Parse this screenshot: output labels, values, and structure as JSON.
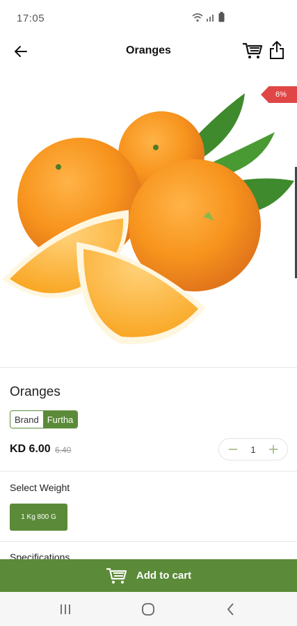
{
  "status_bar": {
    "time": "17:05"
  },
  "header": {
    "title": "Oranges"
  },
  "hero": {
    "discount_badge": "6%"
  },
  "product": {
    "name": "Oranges",
    "brand_label": "Brand",
    "brand_value": "Furtha",
    "price": "KD 6.00",
    "old_price": "6.40",
    "quantity": "1"
  },
  "weight": {
    "section_label": "Select Weight",
    "options": [
      "1 Kg 800 G"
    ]
  },
  "specifications": {
    "section_label": "Specifications"
  },
  "footer": {
    "add_to_cart_label": "Add to cart"
  },
  "colors": {
    "brand_green": "#5b8a38",
    "badge_red": "#e04646"
  },
  "icons": [
    "wifi-icon",
    "signal-icon",
    "battery-icon",
    "back-arrow-icon",
    "cart-icon",
    "share-icon",
    "minus-icon",
    "plus-icon",
    "recent-apps-icon",
    "home-icon",
    "nav-back-icon"
  ]
}
